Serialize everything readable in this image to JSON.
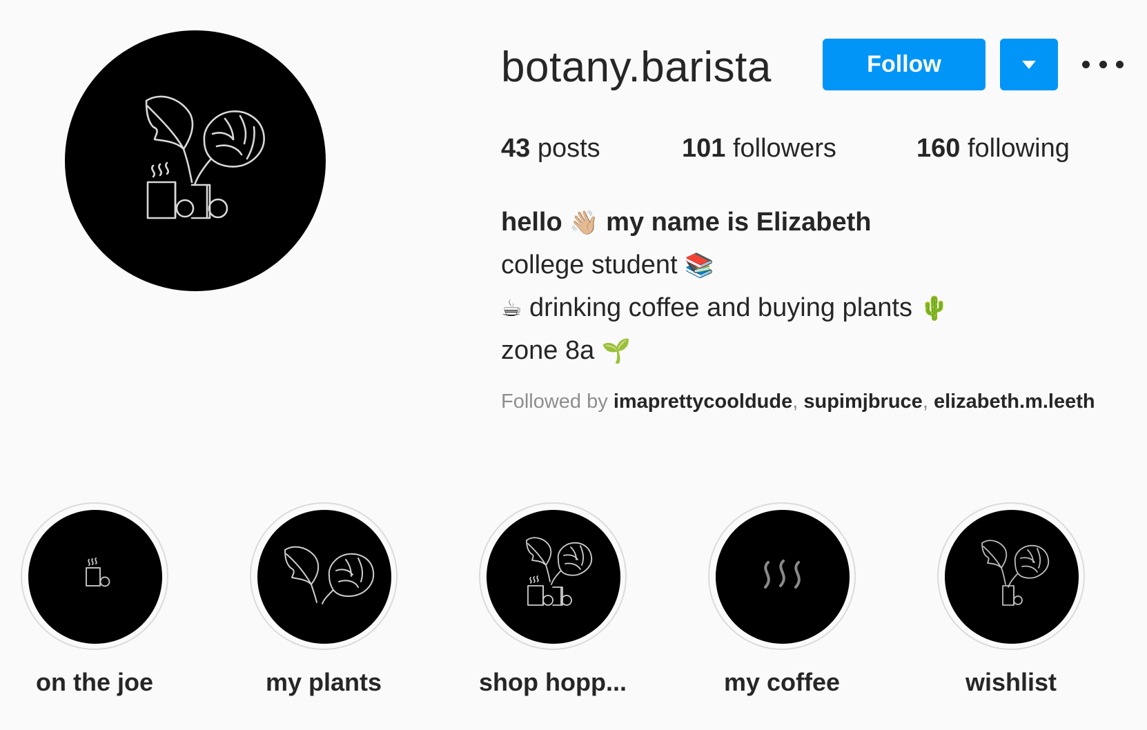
{
  "profile": {
    "username": "botany.barista",
    "follow_label": "Follow",
    "avatar_icon": "plant-coffee-logo-icon"
  },
  "stats": {
    "posts_count": "43",
    "posts_label": "posts",
    "followers_count": "101",
    "followers_label": "followers",
    "following_count": "160",
    "following_label": "following"
  },
  "bio": {
    "line1_a": "hello",
    "line1_emoji": "👋🏼",
    "line1_b": "my name is Elizabeth",
    "line2_text": "college student",
    "line2_emoji": "📚",
    "line3_emoji_a": "☕",
    "line3_text": "drinking coffee and buying plants",
    "line3_emoji_b": "🌵",
    "line4_text": "zone 8a",
    "line4_emoji": "🌱"
  },
  "followed_by": {
    "prefix": "Followed by",
    "users": [
      "imaprettycooldude",
      "supimjbruce",
      "elizabeth.m.leeth"
    ],
    "sep": ","
  },
  "highlights": [
    {
      "label": "on the joe",
      "icon": "coffee-cup-icon"
    },
    {
      "label": "my plants",
      "icon": "plant-leaves-icon"
    },
    {
      "label": "shop hopp...",
      "icon": "plant-coffee-logo-icon"
    },
    {
      "label": "my coffee",
      "icon": "steam-icon"
    },
    {
      "label": "wishlist",
      "icon": "potted-plant-icon"
    }
  ],
  "colors": {
    "accent": "#0095f6",
    "background": "#fafafa",
    "text": "#262626",
    "muted": "#8e8e8e"
  }
}
